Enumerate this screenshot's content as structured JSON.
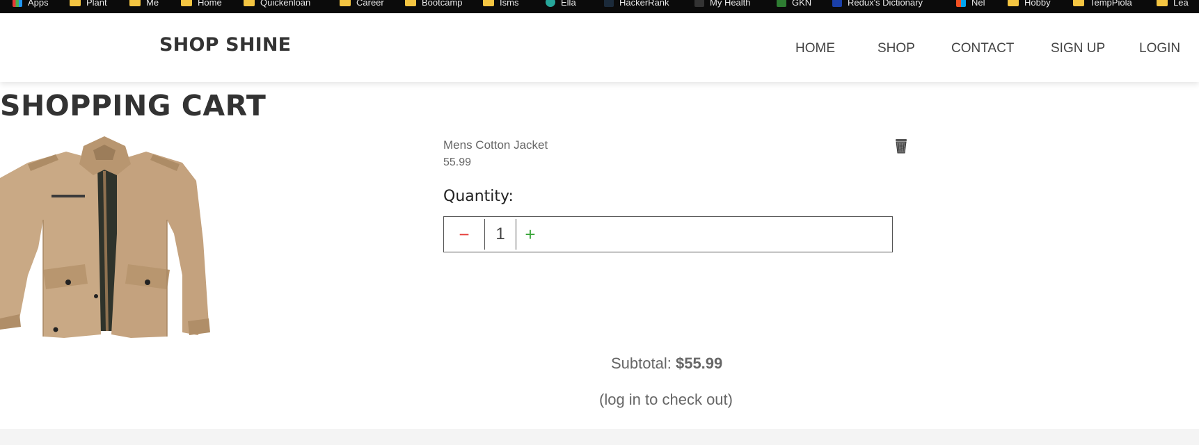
{
  "bookmarks": [
    {
      "label": "Apps",
      "icon": "apps-grid-icon"
    },
    {
      "label": "Plant",
      "icon": "folder-icon"
    },
    {
      "label": "Me",
      "icon": "folder-icon"
    },
    {
      "label": "Home",
      "icon": "folder-icon"
    },
    {
      "label": "Quickenloan",
      "icon": "folder-icon"
    },
    {
      "label": "Career",
      "icon": "folder-icon"
    },
    {
      "label": "Bootcamp",
      "icon": "folder-icon"
    },
    {
      "label": "Isms",
      "icon": "folder-icon"
    },
    {
      "label": "Ella",
      "icon": "site-icon"
    },
    {
      "label": "HackerRank",
      "icon": "site-icon"
    },
    {
      "label": "My Health",
      "icon": "site-icon"
    },
    {
      "label": "GKN",
      "icon": "site-icon"
    },
    {
      "label": "Redux's Dictionary",
      "icon": "site-icon"
    },
    {
      "label": "Nel",
      "icon": "site-icon"
    },
    {
      "label": "Hobby",
      "icon": "folder-icon"
    },
    {
      "label": "TempPiola",
      "icon": "folder-icon"
    },
    {
      "label": "Lea",
      "icon": "folder-icon"
    }
  ],
  "navbar": {
    "brand": "SHOP SHINE",
    "links": [
      "HOME",
      "SHOP",
      "CONTACT",
      "SIGN UP",
      "LOGIN"
    ]
  },
  "page": {
    "title": "SHOPPING CART"
  },
  "cart": {
    "item": {
      "name": "Mens Cotton Jacket",
      "price": "55.99",
      "image_icon": "jacket-image",
      "remove_icon": "trash-icon"
    },
    "quantity_label": "Quantity:",
    "quantity": {
      "minus": "−",
      "value": "1",
      "plus": "+"
    },
    "subtotal_label": "Subtotal:",
    "subtotal_value": "$55.99",
    "checkout_note": "(log in to check out)"
  },
  "colors": {
    "minus": "#e53935",
    "plus": "#3aa63a",
    "text": "#333333",
    "muted": "#666666",
    "footer": "#f4f4f4"
  }
}
